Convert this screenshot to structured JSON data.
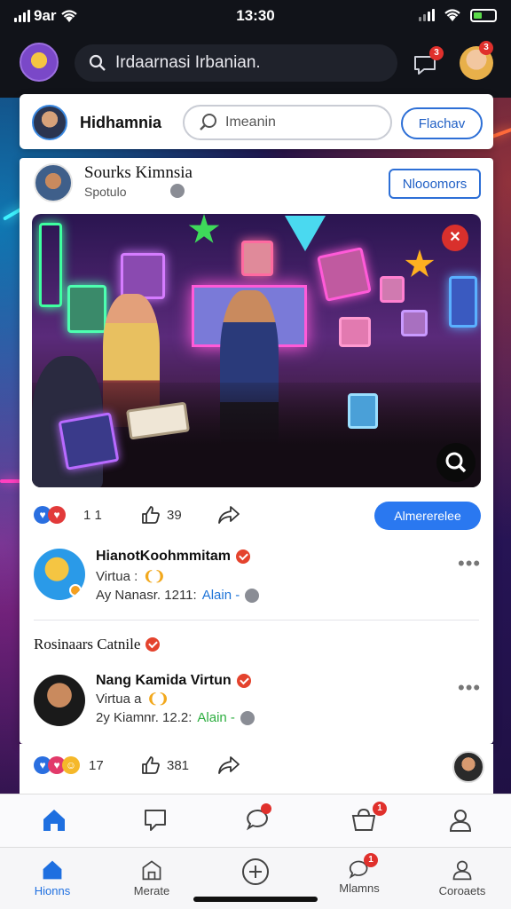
{
  "status_bar": {
    "carrier": "9ar",
    "time": "13:30"
  },
  "top_bar": {
    "search_placeholder": "Irdaarnasi Irbanian.",
    "notifications_badge": "3",
    "profile_badge": "3"
  },
  "profile_bar": {
    "name": "Hidhamnia",
    "input_placeholder": "Imeanin",
    "button_label": "Flachav"
  },
  "post": {
    "author": "Sourks Kimnsia",
    "subtitle": "Spotulo",
    "follow_button": "Nlooomors",
    "reactions": {
      "likes": "1 1",
      "shares": "39"
    },
    "action_button": "Almererelee"
  },
  "comments": [
    {
      "name": "HianotKoohmmitam",
      "line1": "Virtua :",
      "time_text": "Ay Nanasr. 1211:",
      "link": "Alain -"
    },
    {
      "name": "Nang Kamida Virtun",
      "line1": "Virtua a",
      "time_text": "2y Kiamnr. 12.2:",
      "link": "Alain -"
    }
  ],
  "section_title": "Rosinaars Catnile",
  "bottom_reactions": {
    "likes": "17",
    "shares": "381"
  },
  "nav_bottom": {
    "tabs": [
      {
        "label": "Hionns",
        "icon": "home-icon"
      },
      {
        "label": "Merate",
        "icon": "building-icon"
      },
      {
        "label": "",
        "icon": "plus-circle-icon"
      },
      {
        "label": "Mlamns",
        "icon": "chat-icon"
      },
      {
        "label": "Coroaets",
        "icon": "person-icon"
      }
    ]
  },
  "colors": {
    "accent": "#2a78f0",
    "badge": "#e0302c",
    "verified": "#e4432d",
    "link_green": "#2cae3f"
  }
}
